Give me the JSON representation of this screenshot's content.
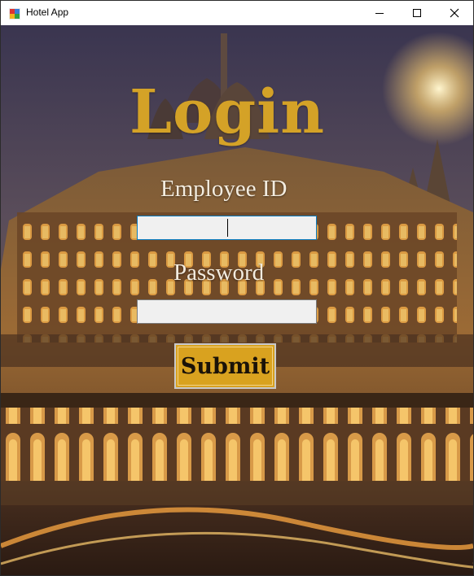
{
  "window": {
    "title": "Hotel App",
    "icon": "app-icon"
  },
  "controls": {
    "minimize": "minimize-icon",
    "maximize": "maximize-icon",
    "close": "close-icon"
  },
  "form": {
    "heading": "Login",
    "employee_label": "Employee ID",
    "employee_value": "",
    "password_label": "Password",
    "password_value": "",
    "submit_label": "Submit"
  },
  "colors": {
    "heading": "#d4a227",
    "button": "#d9a21f",
    "label": "#f3ecdf",
    "input_bg": "#f0f0f0"
  }
}
